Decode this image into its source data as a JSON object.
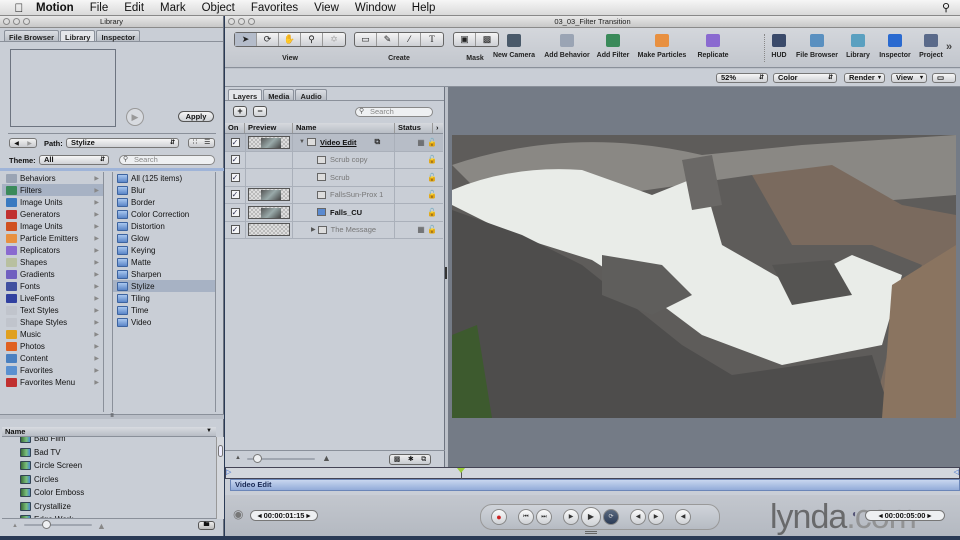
{
  "menubar": {
    "app": "Motion",
    "items": [
      "File",
      "Edit",
      "Mark",
      "Object",
      "Favorites",
      "View",
      "Window",
      "Help"
    ]
  },
  "library_window": {
    "title": "Library",
    "tabs": [
      "File Browser",
      "Library",
      "Inspector"
    ],
    "active_tab": "Library",
    "apply_label": "Apply",
    "path_label": "Path:",
    "path_value": "Stylize",
    "theme_label": "Theme:",
    "theme_value": "All",
    "search_placeholder": "Search",
    "categories": [
      {
        "label": "Behaviors",
        "icon": "behaviors-icon",
        "color": "#9aa4b4"
      },
      {
        "label": "Filters",
        "icon": "filters-icon",
        "color": "#3a8a5a",
        "selected": true
      },
      {
        "label": "Image Units",
        "icon": "image-units-icon",
        "color": "#3a7ac0"
      },
      {
        "label": "Generators",
        "icon": "generators-icon",
        "color": "#c03030"
      },
      {
        "label": "Image Units",
        "icon": "image-units-icon",
        "color": "#d05020"
      },
      {
        "label": "Particle Emitters",
        "icon": "particle-emitters-icon",
        "color": "#e89040"
      },
      {
        "label": "Replicators",
        "icon": "replicators-icon",
        "color": "#8a6ad0"
      },
      {
        "label": "Shapes",
        "icon": "shapes-icon",
        "color": "#b8c0a0"
      },
      {
        "label": "Gradients",
        "icon": "gradients-icon",
        "color": "#7060c0"
      },
      {
        "label": "Fonts",
        "icon": "fonts-icon",
        "color": "#4050a0"
      },
      {
        "label": "LiveFonts",
        "icon": "livefonts-icon",
        "color": "#3040a0"
      },
      {
        "label": "Text Styles",
        "icon": "text-styles-icon",
        "color": "#c0c4cc"
      },
      {
        "label": "Shape Styles",
        "icon": "shape-styles-icon",
        "color": "#c0c4cc"
      },
      {
        "label": "Music",
        "icon": "music-icon",
        "color": "#e0a020"
      },
      {
        "label": "Photos",
        "icon": "photos-icon",
        "color": "#e06020"
      },
      {
        "label": "Content",
        "icon": "content-icon",
        "color": "#4a80c0"
      },
      {
        "label": "Favorites",
        "icon": "favorites-icon",
        "color": "#5a90d0"
      },
      {
        "label": "Favorites Menu",
        "icon": "favorites-menu-icon",
        "color": "#c03030"
      }
    ],
    "subfolders": [
      {
        "label": "All (125 items)"
      },
      {
        "label": "Blur"
      },
      {
        "label": "Border"
      },
      {
        "label": "Color Correction"
      },
      {
        "label": "Distortion"
      },
      {
        "label": "Glow"
      },
      {
        "label": "Keying"
      },
      {
        "label": "Matte"
      },
      {
        "label": "Sharpen"
      },
      {
        "label": "Stylize",
        "selected": true
      },
      {
        "label": "Tiling"
      },
      {
        "label": "Time"
      },
      {
        "label": "Video"
      }
    ],
    "name_header": "Name",
    "items": [
      "Bad Film",
      "Bad TV",
      "Circle Screen",
      "Circles",
      "Color Emboss",
      "Crystallize",
      "Edge Work"
    ]
  },
  "main_window": {
    "title": "03_03_Filter Transition",
    "toolbar": {
      "groups": [
        {
          "label": "View",
          "tools": [
            "select-arrow-icon",
            "adjust-3d-icon",
            "pan-hand-icon",
            "zoom-magnifier-icon",
            "walk-camera-icon"
          ]
        },
        {
          "label": "Create",
          "tools": [
            "rectangle-icon",
            "bezier-icon",
            "paint-stroke-icon",
            "text-icon"
          ]
        },
        {
          "label": "Mask",
          "tools": [
            "rect-mask-icon",
            "bezier-mask-icon"
          ]
        }
      ],
      "buttons": [
        {
          "label": "New Camera",
          "icon": "new-camera-icon",
          "color": "#4a5a6a"
        },
        {
          "label": "Add Behavior",
          "icon": "add-behavior-icon",
          "color": "#9aa4b4"
        },
        {
          "label": "Add Filter",
          "icon": "add-filter-icon",
          "color": "#3a8a5a"
        },
        {
          "label": "Make Particles",
          "icon": "make-particles-icon",
          "color": "#e89040"
        },
        {
          "label": "Replicate",
          "icon": "replicate-icon",
          "color": "#8a6ad0"
        },
        {
          "label": "HUD",
          "icon": "hud-icon",
          "color": "#3a4a6a"
        },
        {
          "label": "File Browser",
          "icon": "file-browser-icon",
          "color": "#5a90c0"
        },
        {
          "label": "Library",
          "icon": "library-icon",
          "color": "#5aa0c0"
        },
        {
          "label": "Inspector",
          "icon": "inspector-icon",
          "color": "#2a6ad0"
        },
        {
          "label": "Project",
          "icon": "project-icon",
          "color": "#5a6a8a"
        }
      ],
      "overflow": "»"
    },
    "canvas_controls": {
      "zoom": "52%",
      "channel": "Color",
      "render": "Render",
      "view": "View"
    },
    "layers_panel": {
      "tabs": [
        "Layers",
        "Media",
        "Audio"
      ],
      "active_tab": "Layers",
      "search_placeholder": "Search",
      "columns": [
        "On",
        "Preview",
        "Name",
        "Status"
      ],
      "rows": [
        {
          "name": "Video Edit",
          "type": "group",
          "on": true,
          "thumb": true,
          "indent": 0,
          "bold": true,
          "underline": true,
          "expanded": true
        },
        {
          "name": "Scrub copy",
          "type": "clone",
          "on": true,
          "thumb": false,
          "indent": 2,
          "bold": false
        },
        {
          "name": "Scrub",
          "type": "clone",
          "on": true,
          "thumb": false,
          "indent": 2,
          "bold": false
        },
        {
          "name": "FallsSun-Prox 1",
          "type": "film",
          "on": true,
          "thumb": true,
          "indent": 2,
          "bold": false
        },
        {
          "name": "Falls_CU",
          "type": "image",
          "on": true,
          "thumb": true,
          "indent": 2,
          "bold": true
        },
        {
          "name": "The Message",
          "type": "group",
          "on": true,
          "thumb": true,
          "indent": 1,
          "bold": false,
          "expanded": false
        }
      ]
    },
    "timeline": {
      "track_label": "Video Edit",
      "playhead_fraction": 0.32
    },
    "transport": {
      "current_time": "00:00:01:15",
      "duration": "00:00:05:00",
      "buttons": [
        "record",
        "go-to-start",
        "go-to-end",
        "play-from-start",
        "play",
        "loop",
        "previous-frame",
        "next-frame",
        "audio"
      ]
    }
  },
  "watermark": {
    "text1": "lynda",
    "text2": ".com"
  }
}
